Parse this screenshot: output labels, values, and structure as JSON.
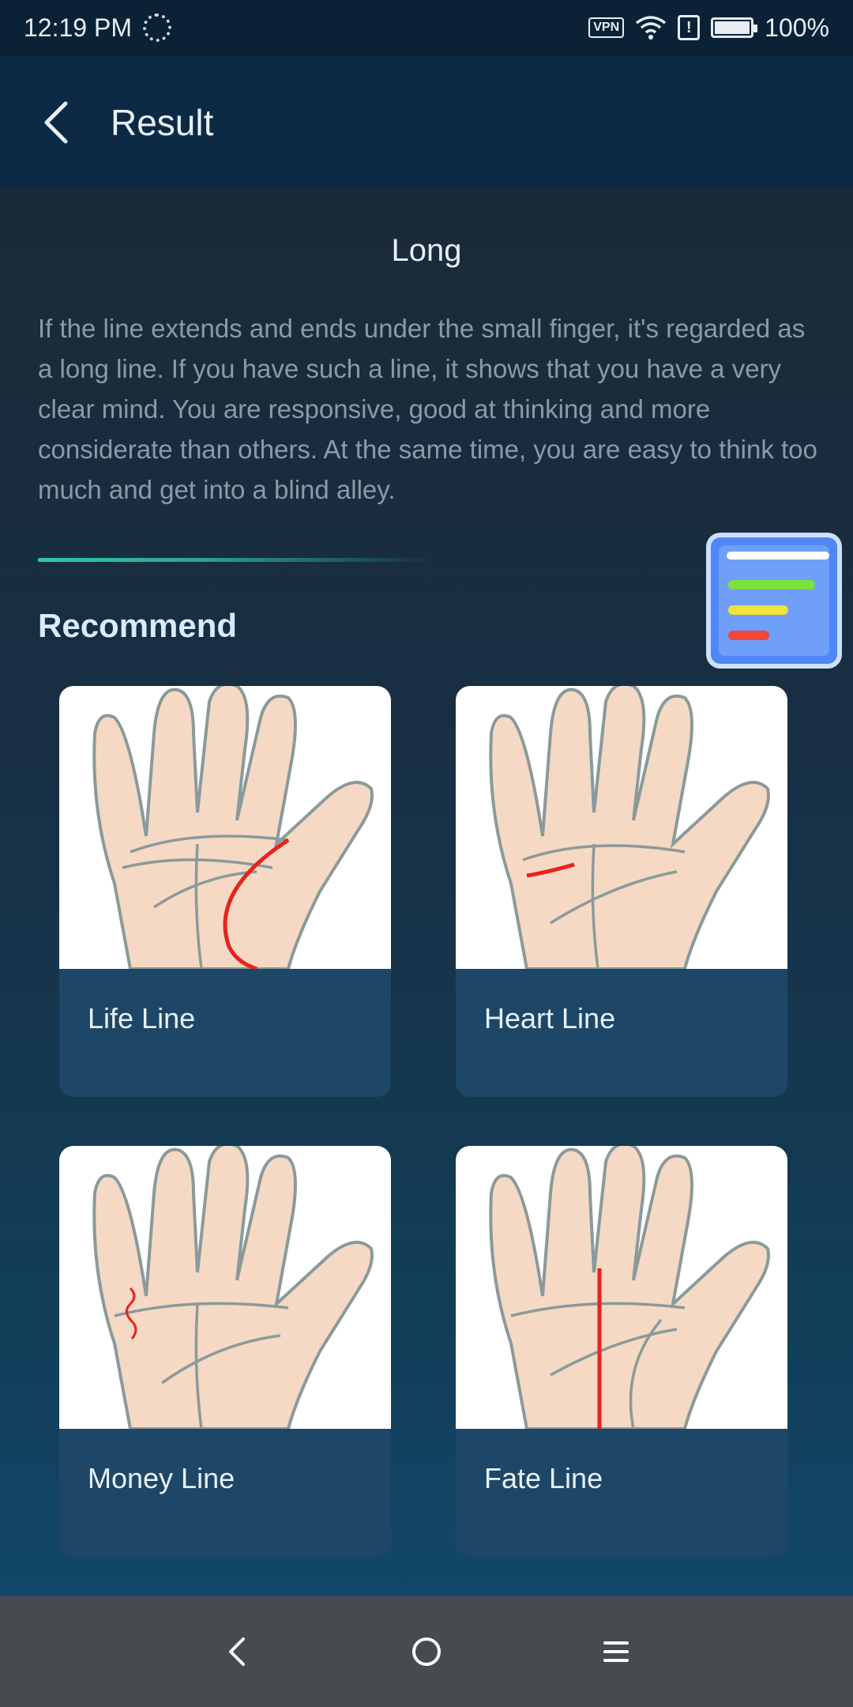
{
  "status_bar": {
    "time": "12:19 PM",
    "vpn_label": "VPN",
    "alert_label": "!",
    "battery": "100%"
  },
  "app_bar": {
    "title": "Result",
    "back_icon": "chevron-left-icon"
  },
  "result": {
    "title": "Long",
    "description": "If the line extends and ends under the small finger, it's regarded as a long line. If you have such a line, it shows that you have a very clear mind. You are responsive, good at thinking and more considerate than others. At the same time, you are easy to think too much and get into a blind alley."
  },
  "recommend": {
    "heading": "Recommend",
    "cards": [
      {
        "label": "Life Line"
      },
      {
        "label": "Heart Line"
      },
      {
        "label": "Money Line"
      },
      {
        "label": "Fate Line"
      }
    ]
  },
  "colors": {
    "accent_line": "#2ec9a8",
    "palm_highlight": "#e8231e",
    "skin": "#f5d9c4",
    "widget_blue": "#4f88f6"
  },
  "nav_bar": {
    "items": [
      "back-icon",
      "home-icon",
      "menu-icon"
    ]
  }
}
